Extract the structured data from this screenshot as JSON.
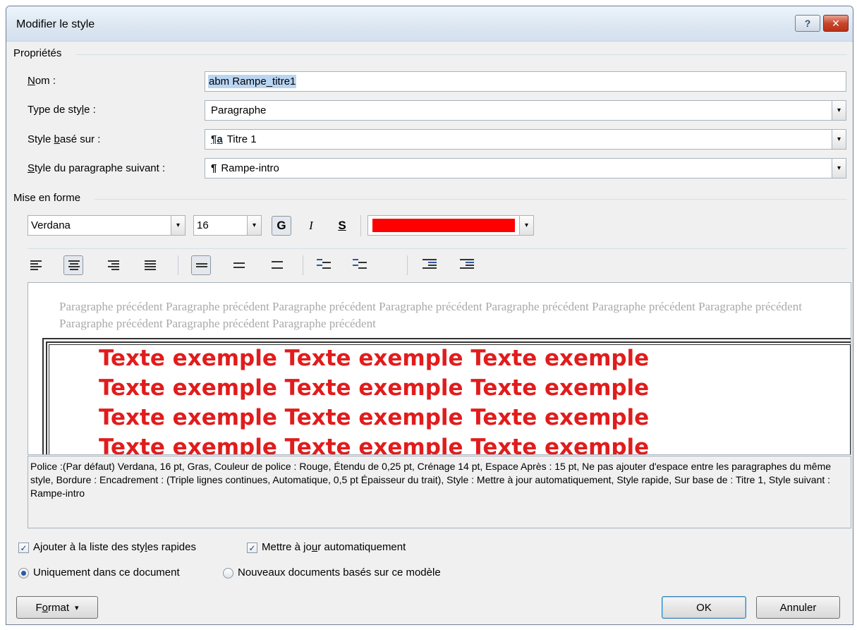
{
  "window": {
    "title": "Modifier le style",
    "help_glyph": "?",
    "close_glyph": "✕"
  },
  "properties": {
    "group_label": "Propriétés",
    "name_label_u": "N",
    "name_label_rest": "om :",
    "name_value": "abm Rampe_titre1",
    "type_label_pre": "Type de sty",
    "type_label_u": "l",
    "type_label_post": "e :",
    "type_value": "Paragraphe",
    "based_label_pre": "Style ",
    "based_label_u": "b",
    "based_label_post": "asé sur :",
    "based_value": "Titre 1",
    "based_glyph": "¶a",
    "next_label_u": "S",
    "next_label_rest": "tyle du paragraphe suivant :",
    "next_value": "Rampe-intro",
    "next_glyph": "¶"
  },
  "formatting": {
    "group_label": "Mise en forme",
    "font": "Verdana",
    "size": "16",
    "bold": "G",
    "italic": "I",
    "underline": "S",
    "font_color": "#ff0000",
    "dropdown_glyph": "▾"
  },
  "preview": {
    "previous_paragraph": "Paragraphe précédent Paragraphe précédent Paragraphe précédent Paragraphe précédent Paragraphe précédent Paragraphe précédent Paragraphe précédent Paragraphe précédent Paragraphe précédent Paragraphe précédent",
    "sample_line": "Texte exemple Texte exemple Texte exemple",
    "sample_color": "#e11c1c"
  },
  "description": "Police :(Par défaut) Verdana, 16 pt, Gras, Couleur de police : Rouge, Étendu de 0,25 pt, Crénage 14 pt, Espace Après : 15 pt, Ne pas ajouter d'espace entre les paragraphes du même style, Bordure : Encadrement : (Triple lignes continues, Automatique,  0,5 pt Épaisseur du trait), Style : Mettre à jour automatiquement, Style rapide, Sur base de : Titre 1, Style suivant : Rampe-intro",
  "options": {
    "quick_styles_pre": "Ajouter à la liste des sty",
    "quick_styles_u": "l",
    "quick_styles_post": "es rapides",
    "quick_styles_checked": true,
    "auto_update_pre": "Mettre à jo",
    "auto_update_u": "u",
    "auto_update_post": "r automatiquement",
    "auto_update_checked": true,
    "only_doc": "Uniquement dans ce document",
    "new_docs": "Nouveaux documents basés sur ce modèle",
    "selected_scope": "only_doc",
    "check_glyph": "✓"
  },
  "buttons": {
    "format_u": "o",
    "format_pre": "F",
    "format_post": "rmat",
    "format_arrow": "▾",
    "ok": "OK",
    "cancel": "Annuler"
  }
}
